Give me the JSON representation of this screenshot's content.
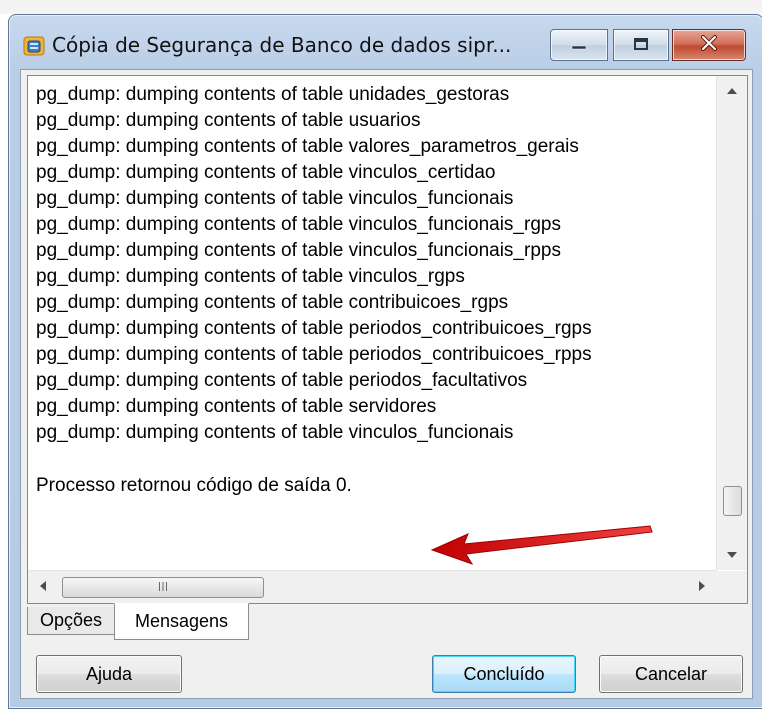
{
  "window": {
    "title": "Cópia de Segurança de Banco de dados sipr..."
  },
  "log": {
    "lines": [
      "pg_dump: dumping contents of table unidades_gestoras",
      "pg_dump: dumping contents of table usuarios",
      "pg_dump: dumping contents of table valores_parametros_gerais",
      "pg_dump: dumping contents of table vinculos_certidao",
      "pg_dump: dumping contents of table vinculos_funcionais",
      "pg_dump: dumping contents of table vinculos_funcionais_rgps",
      "pg_dump: dumping contents of table vinculos_funcionais_rpps",
      "pg_dump: dumping contents of table vinculos_rgps",
      "pg_dump: dumping contents of table contribuicoes_rgps",
      "pg_dump: dumping contents of table periodos_contribuicoes_rgps",
      "pg_dump: dumping contents of table periodos_contribuicoes_rpps",
      "pg_dump: dumping contents of table periodos_facultativos",
      "pg_dump: dumping contents of table servidores",
      "pg_dump: dumping contents of table vinculos_funcionais"
    ],
    "exit_message": "Processo retornou código de saída 0."
  },
  "tabs": {
    "options": "Opções",
    "messages": "Mensagens"
  },
  "buttons": {
    "help": "Ajuda",
    "done": "Concluído",
    "cancel": "Cancelar"
  },
  "colors": {
    "annotation_arrow": "#e01010",
    "titlebar": "#b9cde6",
    "close_button": "#c04a33"
  },
  "icons": {
    "app": "database-backup-icon",
    "minimize": "minimize-icon",
    "maximize": "maximize-icon",
    "close": "close-icon"
  }
}
